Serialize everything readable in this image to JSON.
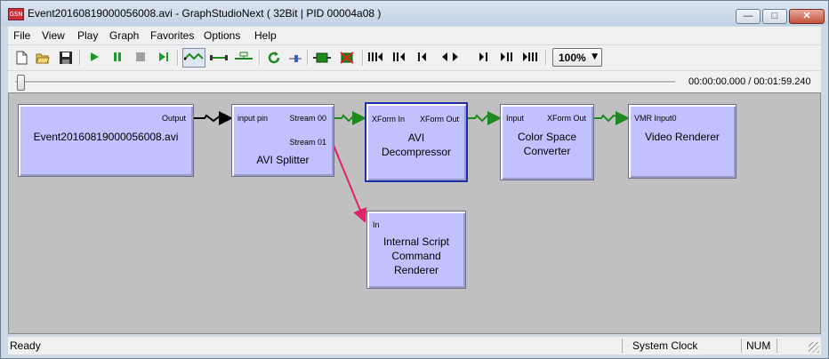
{
  "window": {
    "title": "Event20160819000056008.avi - GraphStudioNext ( 32Bit | PID 00004a08 )",
    "icon_text": "GSN"
  },
  "menu": [
    "File",
    "View",
    "Play",
    "Graph",
    "Favorites",
    "Options",
    "Help"
  ],
  "toolbar": {
    "zoom": "100%",
    "icons": [
      "new-file-icon",
      "open-folder-icon",
      "save-icon",
      "play-icon",
      "pause-icon",
      "stop-icon",
      "step-icon",
      "connect-icon",
      "smart-connect-icon",
      "intelligent-connect-icon",
      "refresh-icon",
      "seek-icon",
      "insert-filter-icon",
      "delete-filter-icon",
      "frame-back-max-icon",
      "frame-back-fast-icon",
      "frame-back-icon",
      "frame-step-icon",
      "frame-forward-icon",
      "frame-forward-fast-icon",
      "frame-forward-max-icon"
    ]
  },
  "seek": {
    "position_fraction": 0.0,
    "time": "00:00:00.000 / 00:01:59.240"
  },
  "graph": {
    "filters": {
      "source": {
        "name": "Event20160819000056008.avi",
        "out_pin": "Output"
      },
      "splitter": {
        "name": "AVI Splitter",
        "in_pin": "input pin",
        "out_pins": [
          "Stream 00",
          "Stream 01"
        ]
      },
      "decompressor": {
        "name_lines": [
          "AVI",
          "Decompressor"
        ],
        "in_pin": "XForm In",
        "out_pin": "XForm Out"
      },
      "colorspace": {
        "name_lines": [
          "Color Space",
          "Converter"
        ],
        "in_pin": "Input",
        "out_pin": "XForm Out"
      },
      "renderer": {
        "name": "Video Renderer",
        "in_pin": "VMR Input0"
      },
      "script": {
        "name_lines": [
          "Internal Script",
          "Command",
          "Renderer"
        ],
        "in_pin": "In"
      }
    },
    "colors": {
      "filter_fill": "#c2c1ff",
      "selected_border": "#1d2fa8",
      "connection_video": "#1e8a1e",
      "connection_source": "#000000",
      "connection_script": "#e0206a",
      "canvas": "#c0c0c0"
    }
  },
  "status": {
    "left": "Ready",
    "clock": "System Clock",
    "num": "NUM"
  }
}
